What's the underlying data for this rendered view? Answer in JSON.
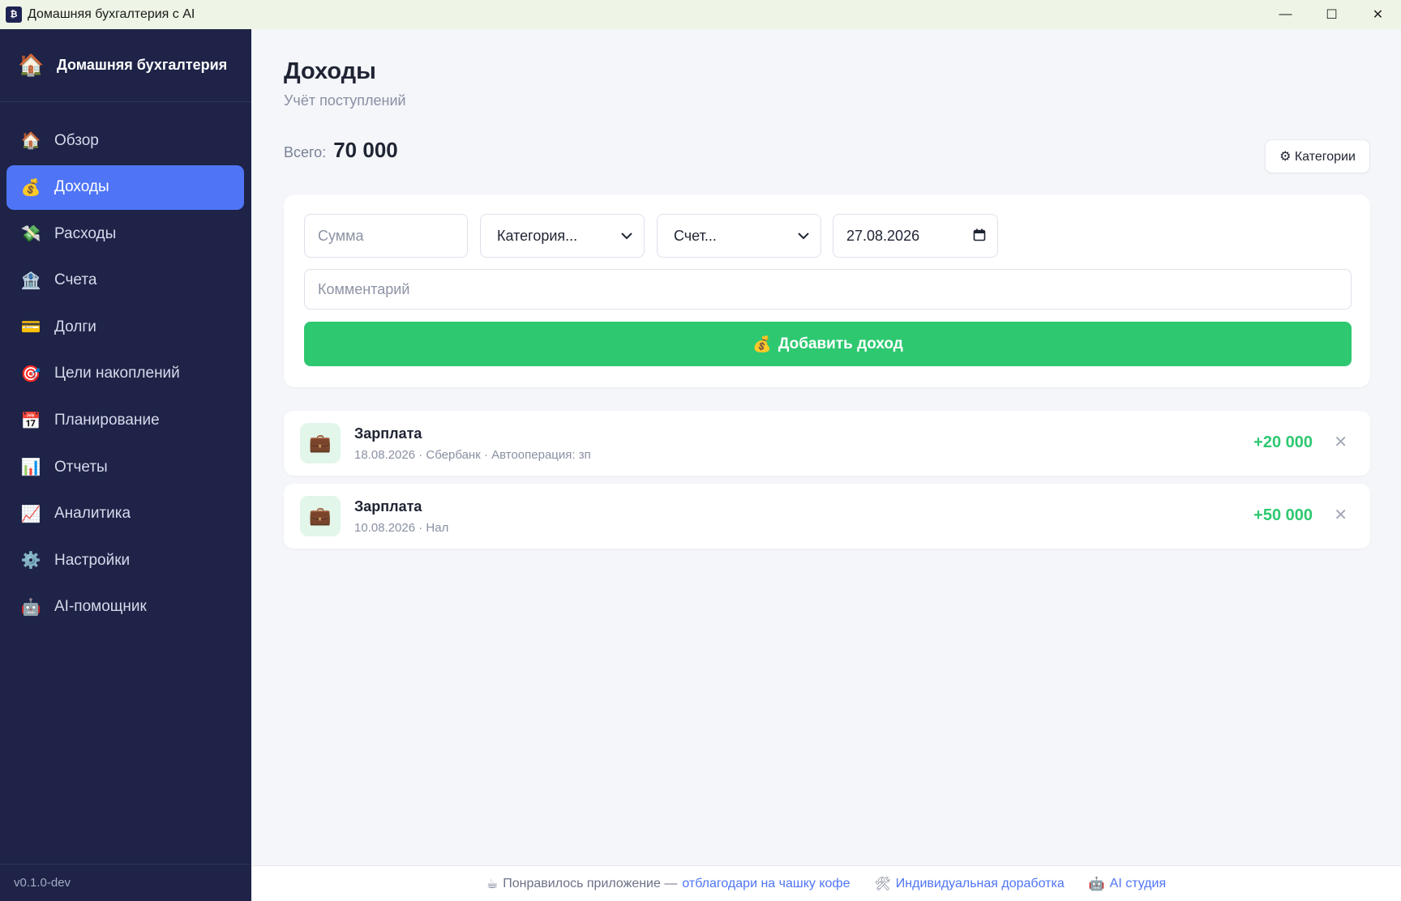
{
  "window": {
    "title": "Домашняя бухгалтерия с AI",
    "minimize": "—",
    "maximize": "☐",
    "close": "✕"
  },
  "sidebar": {
    "brand_icon": "🏠",
    "brand_title": "Домашняя бухгалтерия",
    "items": [
      {
        "icon": "🏠",
        "label": "Обзор"
      },
      {
        "icon": "💰",
        "label": "Доходы"
      },
      {
        "icon": "💸",
        "label": "Расходы"
      },
      {
        "icon": "🏦",
        "label": "Счета"
      },
      {
        "icon": "💳",
        "label": "Долги"
      },
      {
        "icon": "🎯",
        "label": "Цели накоплений"
      },
      {
        "icon": "📅",
        "label": "Планирование"
      },
      {
        "icon": "📊",
        "label": "Отчеты"
      },
      {
        "icon": "📈",
        "label": "Аналитика"
      },
      {
        "icon": "⚙️",
        "label": "Настройки"
      },
      {
        "icon": "🤖",
        "label": "AI-помощник"
      }
    ],
    "active_index": 1,
    "version": "v0.1.0-dev"
  },
  "page": {
    "title": "Доходы",
    "subtitle": "Учёт поступлений",
    "total_label": "Всего:",
    "total_value": "70 000",
    "categories_button": "⚙ Категории"
  },
  "form": {
    "amount_placeholder": "Сумма",
    "category_value": "Категория...",
    "account_value": "Счет...",
    "date_value": "27.08.2026",
    "comment_placeholder": "Комментарий",
    "add_button_icon": "💰",
    "add_button_label": "Добавить доход"
  },
  "incomes": [
    {
      "icon": "💼",
      "title": "Зарплата",
      "subtitle": "18.08.2026 · Сбербанк · Автооперация: зп",
      "amount": "+20 000"
    },
    {
      "icon": "💼",
      "title": "Зарплата",
      "subtitle": "10.08.2026 · Нал",
      "amount": "+50 000"
    }
  ],
  "footer": {
    "coffee_icon": "☕",
    "text": "Понравилось приложение —",
    "coffee_link": "отблагодари на чашку кофе",
    "tools_icon": "🛠",
    "custom_link": "Индивидуальная доработка",
    "ai_icon": "🤖",
    "ai_link": "AI студия"
  },
  "colors": {
    "sidebar_bg": "#1e2347",
    "accent": "#4f75f6",
    "success": "#2ec871"
  }
}
